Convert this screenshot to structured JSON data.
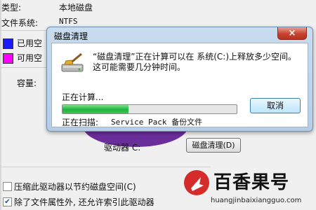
{
  "properties": {
    "type_label": "类型:",
    "type_value": "本地磁盘",
    "fs_label": "文件系统:",
    "fs_value": "NTFS",
    "used_label": "已用空",
    "free_label": "可用空",
    "capacity_label": "容量:",
    "drive_label": "驱动器 C:",
    "cleanup_button": "磁盘清理(D)",
    "compress_label": "压缩此驱动器以节约磁盘空间(C)",
    "index_label": "除了文件属性外, 还允许索引此驱动器",
    "compress_checked": false,
    "index_checked": true,
    "used_color": "#1a1aff",
    "free_color": "#ff00ff"
  },
  "dialog": {
    "title": "磁盘清理",
    "close_glyph": "×",
    "message": "“磁盘清理”正在计算可以在 系统(C:)上释放多少空间。这可能需要几分钟时间。",
    "status": "正在计算...",
    "progress_percent": 38,
    "cancel_label": "取消",
    "scanning_label": "正在扫描:",
    "scanning_item": "Service Pack 备份文件",
    "icon": "disk-cleanup-icon"
  },
  "watermark": {
    "name": "百香果号",
    "url": "huangjinbaixiangguo.com"
  }
}
